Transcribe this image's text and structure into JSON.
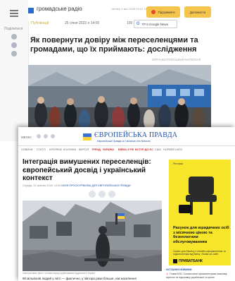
{
  "hromadske": {
    "logo": "громадське радіо",
    "logo_sub": "",
    "meta": "Четвер 2 квіт   2025 03:41 15",
    "btn_support": "Підтримати",
    "btn_donate": "Допомогти",
    "section": "Публікації",
    "date": "25 січня 2022 о 14:00",
    "views": "100",
    "gnews": "ГР в Google News",
    "title": "Як повернути довіру між переселенцями та громадами, що їх приймають: дослідження",
    "label": "ОРГАНІЗАТОРСЬКИЙ МАТЕРІАЛ"
  },
  "pravda": {
    "menu": "МЕНЮ",
    "logo": "ЄВРОПЕЙСЬКА ПРАВДА",
    "logo_sub": "Європейська Правда on Ukrainian Info Network",
    "nav": [
      "НОВИНИ",
      "СТАТТІ",
      "ІНТЕРВ'Ю",
      "КОЛОНКИ",
      "ВЕРСІЯ",
      "ТРЕНД",
      "УКРАЇНА",
      "ВІЙНА З РФ",
      "ВСТУП ДО ЄС",
      "США",
      "НОРВЕЙ НАТО"
    ],
    "title": "Інтеграція вимушених переселенців: європейський досвід і український контекст",
    "byline_date": "Середа, 22 жовтня 2025, 13:00",
    "byline_author": "ЮЛІЯ ПРОСКУРЯКОВА ДЛЯ ЄВРОПЕЙСЬКОЇ ПРАВДИ",
    "caption": "Ілюстративне фото: чоловік перед зруйнованим будинком в Україні",
    "lead": "90 мільйонів людей у світі — фактично, у півтора рази більше, ніж населення",
    "ad": {
      "badge": "Реклама",
      "headline": "Рахунок для юридичних осіб з місячною ціною та безоплатним обслуговуванням",
      "note": "Сервіс для бізнесу з онлайн-оформленням та підключенням від банку. Умови на сайті.",
      "brand": "ПРИВАТБАНК"
    },
    "news_head": "ОСТАННІ НОВИНИ",
    "news_item": "Глава МЗС Словаччини прокоментував можливу агресію та підтримку української сторони"
  }
}
